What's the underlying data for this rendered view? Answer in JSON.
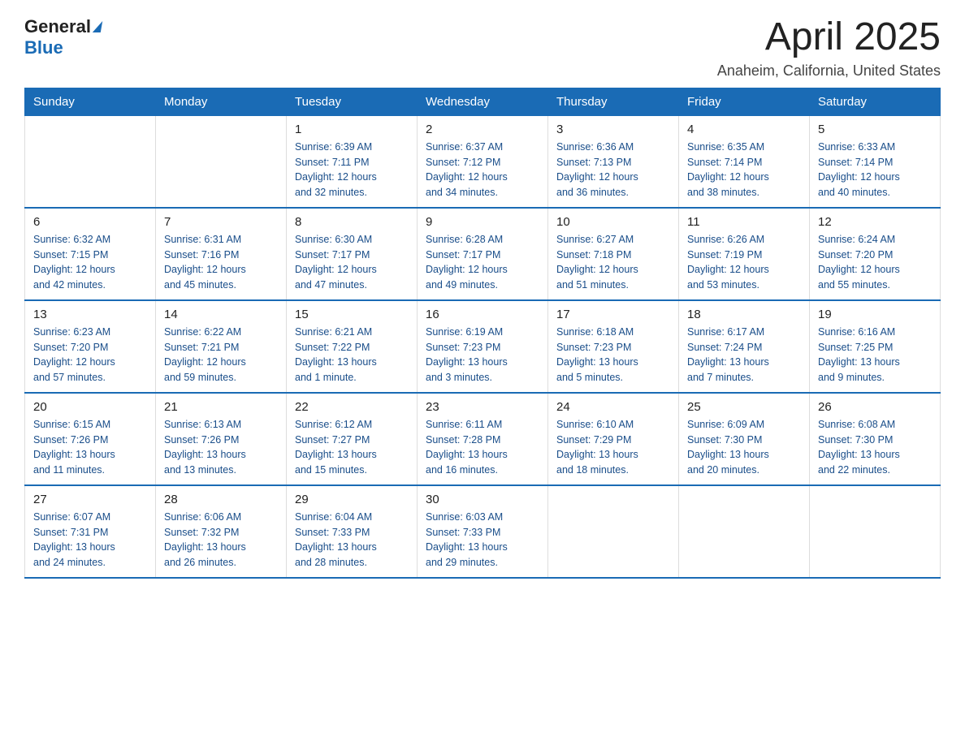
{
  "header": {
    "logo": {
      "general": "General",
      "blue": "Blue"
    },
    "title": "April 2025",
    "location": "Anaheim, California, United States"
  },
  "weekdays": [
    "Sunday",
    "Monday",
    "Tuesday",
    "Wednesday",
    "Thursday",
    "Friday",
    "Saturday"
  ],
  "weeks": [
    [
      {
        "day": "",
        "info": ""
      },
      {
        "day": "",
        "info": ""
      },
      {
        "day": "1",
        "info": "Sunrise: 6:39 AM\nSunset: 7:11 PM\nDaylight: 12 hours\nand 32 minutes."
      },
      {
        "day": "2",
        "info": "Sunrise: 6:37 AM\nSunset: 7:12 PM\nDaylight: 12 hours\nand 34 minutes."
      },
      {
        "day": "3",
        "info": "Sunrise: 6:36 AM\nSunset: 7:13 PM\nDaylight: 12 hours\nand 36 minutes."
      },
      {
        "day": "4",
        "info": "Sunrise: 6:35 AM\nSunset: 7:14 PM\nDaylight: 12 hours\nand 38 minutes."
      },
      {
        "day": "5",
        "info": "Sunrise: 6:33 AM\nSunset: 7:14 PM\nDaylight: 12 hours\nand 40 minutes."
      }
    ],
    [
      {
        "day": "6",
        "info": "Sunrise: 6:32 AM\nSunset: 7:15 PM\nDaylight: 12 hours\nand 42 minutes."
      },
      {
        "day": "7",
        "info": "Sunrise: 6:31 AM\nSunset: 7:16 PM\nDaylight: 12 hours\nand 45 minutes."
      },
      {
        "day": "8",
        "info": "Sunrise: 6:30 AM\nSunset: 7:17 PM\nDaylight: 12 hours\nand 47 minutes."
      },
      {
        "day": "9",
        "info": "Sunrise: 6:28 AM\nSunset: 7:17 PM\nDaylight: 12 hours\nand 49 minutes."
      },
      {
        "day": "10",
        "info": "Sunrise: 6:27 AM\nSunset: 7:18 PM\nDaylight: 12 hours\nand 51 minutes."
      },
      {
        "day": "11",
        "info": "Sunrise: 6:26 AM\nSunset: 7:19 PM\nDaylight: 12 hours\nand 53 minutes."
      },
      {
        "day": "12",
        "info": "Sunrise: 6:24 AM\nSunset: 7:20 PM\nDaylight: 12 hours\nand 55 minutes."
      }
    ],
    [
      {
        "day": "13",
        "info": "Sunrise: 6:23 AM\nSunset: 7:20 PM\nDaylight: 12 hours\nand 57 minutes."
      },
      {
        "day": "14",
        "info": "Sunrise: 6:22 AM\nSunset: 7:21 PM\nDaylight: 12 hours\nand 59 minutes."
      },
      {
        "day": "15",
        "info": "Sunrise: 6:21 AM\nSunset: 7:22 PM\nDaylight: 13 hours\nand 1 minute."
      },
      {
        "day": "16",
        "info": "Sunrise: 6:19 AM\nSunset: 7:23 PM\nDaylight: 13 hours\nand 3 minutes."
      },
      {
        "day": "17",
        "info": "Sunrise: 6:18 AM\nSunset: 7:23 PM\nDaylight: 13 hours\nand 5 minutes."
      },
      {
        "day": "18",
        "info": "Sunrise: 6:17 AM\nSunset: 7:24 PM\nDaylight: 13 hours\nand 7 minutes."
      },
      {
        "day": "19",
        "info": "Sunrise: 6:16 AM\nSunset: 7:25 PM\nDaylight: 13 hours\nand 9 minutes."
      }
    ],
    [
      {
        "day": "20",
        "info": "Sunrise: 6:15 AM\nSunset: 7:26 PM\nDaylight: 13 hours\nand 11 minutes."
      },
      {
        "day": "21",
        "info": "Sunrise: 6:13 AM\nSunset: 7:26 PM\nDaylight: 13 hours\nand 13 minutes."
      },
      {
        "day": "22",
        "info": "Sunrise: 6:12 AM\nSunset: 7:27 PM\nDaylight: 13 hours\nand 15 minutes."
      },
      {
        "day": "23",
        "info": "Sunrise: 6:11 AM\nSunset: 7:28 PM\nDaylight: 13 hours\nand 16 minutes."
      },
      {
        "day": "24",
        "info": "Sunrise: 6:10 AM\nSunset: 7:29 PM\nDaylight: 13 hours\nand 18 minutes."
      },
      {
        "day": "25",
        "info": "Sunrise: 6:09 AM\nSunset: 7:30 PM\nDaylight: 13 hours\nand 20 minutes."
      },
      {
        "day": "26",
        "info": "Sunrise: 6:08 AM\nSunset: 7:30 PM\nDaylight: 13 hours\nand 22 minutes."
      }
    ],
    [
      {
        "day": "27",
        "info": "Sunrise: 6:07 AM\nSunset: 7:31 PM\nDaylight: 13 hours\nand 24 minutes."
      },
      {
        "day": "28",
        "info": "Sunrise: 6:06 AM\nSunset: 7:32 PM\nDaylight: 13 hours\nand 26 minutes."
      },
      {
        "day": "29",
        "info": "Sunrise: 6:04 AM\nSunset: 7:33 PM\nDaylight: 13 hours\nand 28 minutes."
      },
      {
        "day": "30",
        "info": "Sunrise: 6:03 AM\nSunset: 7:33 PM\nDaylight: 13 hours\nand 29 minutes."
      },
      {
        "day": "",
        "info": ""
      },
      {
        "day": "",
        "info": ""
      },
      {
        "day": "",
        "info": ""
      }
    ]
  ]
}
